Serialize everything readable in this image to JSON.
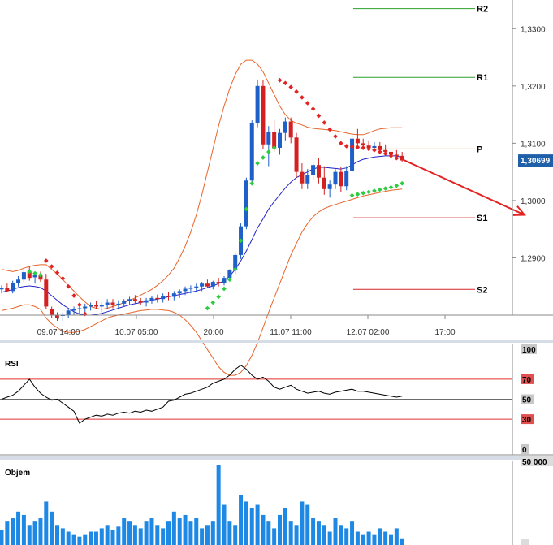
{
  "chart_data": {
    "type": "candlestick",
    "price_panel": {
      "ylim": [
        1.28,
        1.335
      ],
      "y_ticks": [
        "1,3300",
        "1,3200",
        "1,3100",
        "1,3000",
        "1,2900"
      ],
      "current_price_label": "1,30699",
      "x_ticks": [
        "09.07 14:00",
        "10.07 05:00",
        "20:00",
        "11.07 11:00",
        "12.07 02:00",
        "17:00"
      ],
      "pivot_levels": [
        {
          "name": "R2",
          "value": 1.3335,
          "color": "#2ca02c"
        },
        {
          "name": "R1",
          "value": 1.3215,
          "color": "#2ca02c"
        },
        {
          "name": "P",
          "value": 1.309,
          "color": "#f0a030"
        },
        {
          "name": "S1",
          "value": 1.297,
          "color": "#d62728"
        },
        {
          "name": "S2",
          "value": 1.2845,
          "color": "#d62728"
        }
      ],
      "candles": [
        [
          1.2845,
          1.2852,
          1.2838,
          1.2848
        ],
        [
          1.2848,
          1.2855,
          1.284,
          1.2842
        ],
        [
          1.2842,
          1.286,
          1.2838,
          1.2856
        ],
        [
          1.2856,
          1.2868,
          1.285,
          1.2862
        ],
        [
          1.2862,
          1.288,
          1.2855,
          1.2875
        ],
        [
          1.2875,
          1.2885,
          1.286,
          1.2865
        ],
        [
          1.2866,
          1.2875,
          1.2855,
          1.287
        ],
        [
          1.287,
          1.2876,
          1.2858,
          1.2862
        ],
        [
          1.2862,
          1.2872,
          1.281,
          1.2815
        ],
        [
          1.281,
          1.2815,
          1.2795,
          1.28
        ],
        [
          1.28,
          1.2805,
          1.279,
          1.2795
        ],
        [
          1.28,
          1.2805,
          1.279,
          1.28
        ],
        [
          1.28,
          1.2812,
          1.2795,
          1.2808
        ],
        [
          1.2808,
          1.2815,
          1.28,
          1.281
        ],
        [
          1.281,
          1.2818,
          1.28,
          1.2812
        ],
        [
          1.2812,
          1.282,
          1.2805,
          1.2815
        ],
        [
          1.2815,
          1.2822,
          1.2808,
          1.2818
        ],
        [
          1.2818,
          1.2825,
          1.281,
          1.2815
        ],
        [
          1.2815,
          1.2822,
          1.2805,
          1.2818
        ],
        [
          1.2818,
          1.2828,
          1.281,
          1.2822
        ],
        [
          1.2822,
          1.2828,
          1.2812,
          1.2818
        ],
        [
          1.2818,
          1.2826,
          1.2812,
          1.282
        ],
        [
          1.282,
          1.2828,
          1.2815,
          1.2825
        ],
        [
          1.2825,
          1.2832,
          1.2818,
          1.2828
        ],
        [
          1.2828,
          1.2835,
          1.282,
          1.2825
        ],
        [
          1.2825,
          1.283,
          1.2818,
          1.2822
        ],
        [
          1.2822,
          1.283,
          1.2815,
          1.2826
        ],
        [
          1.2826,
          1.2834,
          1.282,
          1.283
        ],
        [
          1.283,
          1.2836,
          1.2822,
          1.2828
        ],
        [
          1.2828,
          1.2838,
          1.2822,
          1.2834
        ],
        [
          1.2834,
          1.284,
          1.2826,
          1.2832
        ],
        [
          1.2832,
          1.2842,
          1.2826,
          1.2838
        ],
        [
          1.2838,
          1.2845,
          1.283,
          1.2842
        ],
        [
          1.2842,
          1.285,
          1.2835,
          1.2846
        ],
        [
          1.2846,
          1.2852,
          1.2838,
          1.2848
        ],
        [
          1.2848,
          1.2855,
          1.284,
          1.285
        ],
        [
          1.285,
          1.2858,
          1.2842,
          1.2855
        ],
        [
          1.2855,
          1.2862,
          1.2848,
          1.285
        ],
        [
          1.285,
          1.286,
          1.2845,
          1.2858
        ],
        [
          1.2858,
          1.2865,
          1.285,
          1.2856
        ],
        [
          1.2856,
          1.2868,
          1.2852,
          1.2865
        ],
        [
          1.2865,
          1.288,
          1.286,
          1.2878
        ],
        [
          1.2878,
          1.291,
          1.2872,
          1.2905
        ],
        [
          1.2905,
          1.296,
          1.2898,
          1.2955
        ],
        [
          1.2955,
          1.304,
          1.295,
          1.3035
        ],
        [
          1.3035,
          1.314,
          1.303,
          1.3135
        ],
        [
          1.3135,
          1.321,
          1.3128,
          1.32
        ],
        [
          1.32,
          1.321,
          1.309,
          1.3098
        ],
        [
          1.3098,
          1.313,
          1.306,
          1.312
        ],
        [
          1.312,
          1.314,
          1.3085,
          1.3092
        ],
        [
          1.3092,
          1.3125,
          1.308,
          1.3118
        ],
        [
          1.3118,
          1.3145,
          1.3105,
          1.3138
        ],
        [
          1.3138,
          1.3145,
          1.31,
          1.311
        ],
        [
          1.311,
          1.3118,
          1.304,
          1.305
        ],
        [
          1.305,
          1.3065,
          1.302,
          1.303
        ],
        [
          1.303,
          1.3055,
          1.302,
          1.3045
        ],
        [
          1.3045,
          1.307,
          1.3035,
          1.3062
        ],
        [
          1.3062,
          1.3075,
          1.303,
          1.304
        ],
        [
          1.304,
          1.306,
          1.301,
          1.302
        ],
        [
          1.302,
          1.3035,
          1.3005,
          1.3028
        ],
        [
          1.3028,
          1.3055,
          1.302,
          1.305
        ],
        [
          1.305,
          1.3058,
          1.3015,
          1.3025
        ],
        [
          1.3025,
          1.306,
          1.3018,
          1.3052
        ],
        [
          1.3052,
          1.3112,
          1.3048,
          1.3108
        ],
        [
          1.3108,
          1.3125,
          1.3095,
          1.31
        ],
        [
          1.31,
          1.3108,
          1.3092,
          1.3096
        ],
        [
          1.3096,
          1.3105,
          1.3088,
          1.3092
        ],
        [
          1.3092,
          1.3102,
          1.3085,
          1.3095
        ],
        [
          1.3095,
          1.3102,
          1.3086,
          1.3088
        ],
        [
          1.3088,
          1.3098,
          1.308,
          1.3085
        ],
        [
          1.3085,
          1.3092,
          1.3075,
          1.308
        ],
        [
          1.308,
          1.3088,
          1.3072,
          1.3078
        ],
        [
          1.3078,
          1.3085,
          1.3068,
          1.307
        ]
      ],
      "sma": [
        1.284,
        1.2842,
        1.2845,
        1.2848,
        1.285,
        1.2851,
        1.285,
        1.2848,
        1.2842,
        1.2834,
        1.2826,
        1.2818,
        1.2812,
        1.2806,
        1.2802,
        1.28,
        1.28,
        1.2801,
        1.2803,
        1.2806,
        1.2809,
        1.2812,
        1.2815,
        1.2818,
        1.282,
        1.2822,
        1.2824,
        1.2826,
        1.2828,
        1.283,
        1.2832,
        1.2834,
        1.2836,
        1.2838,
        1.284,
        1.2842,
        1.2845,
        1.2848,
        1.2851,
        1.2855,
        1.286,
        1.2868,
        1.288,
        1.2895,
        1.2912,
        1.2932,
        1.2952,
        1.2968,
        1.2985,
        1.2998,
        1.301,
        1.3022,
        1.3032,
        1.304,
        1.3045,
        1.305,
        1.3055,
        1.3058,
        1.3058,
        1.3057,
        1.3056,
        1.3055,
        1.3057,
        1.3062,
        1.3068,
        1.3072,
        1.3074,
        1.3076,
        1.3077,
        1.3078,
        1.3078,
        1.3078,
        1.3075
      ],
      "bollinger_upper": [
        1.288,
        1.2878,
        1.2876,
        1.2878,
        1.2882,
        1.2885,
        1.2887,
        1.2888,
        1.2888,
        1.288,
        1.2872,
        1.2862,
        1.2852,
        1.2842,
        1.2832,
        1.2823,
        1.2815,
        1.2812,
        1.281,
        1.2812,
        1.2815,
        1.2818,
        1.2822,
        1.2826,
        1.283,
        1.2835,
        1.284,
        1.2845,
        1.2852,
        1.286,
        1.287,
        1.2882,
        1.29,
        1.292,
        1.2945,
        1.2975,
        1.301,
        1.305,
        1.309,
        1.313,
        1.3165,
        1.3195,
        1.322,
        1.3238,
        1.3245,
        1.3245,
        1.3238,
        1.3225,
        1.3205,
        1.3185,
        1.3165,
        1.315,
        1.314,
        1.3135,
        1.3132,
        1.3128,
        1.3126,
        1.3125,
        1.3124,
        1.3123,
        1.3122,
        1.312,
        1.3118,
        1.3116,
        1.3115,
        1.3115,
        1.3118,
        1.3122,
        1.3125,
        1.3126,
        1.3127,
        1.3127,
        1.3127
      ],
      "bollinger_lower": [
        1.2808,
        1.281,
        1.2812,
        1.2815,
        1.2818,
        1.2818,
        1.2815,
        1.281,
        1.2795,
        1.2785,
        1.2778,
        1.2772,
        1.277,
        1.277,
        1.2772,
        1.2775,
        1.278,
        1.2785,
        1.279,
        1.2795,
        1.2798,
        1.28,
        1.2802,
        1.2804,
        1.2806,
        1.2808,
        1.2809,
        1.281,
        1.281,
        1.2809,
        1.2808,
        1.2805,
        1.28,
        1.2792,
        1.2782,
        1.277,
        1.2755,
        1.274,
        1.2725,
        1.271,
        1.27,
        1.2695,
        1.2695,
        1.27,
        1.2712,
        1.273,
        1.2752,
        1.2778,
        1.2805,
        1.283,
        1.2855,
        1.288,
        1.2905,
        1.2925,
        1.2945,
        1.296,
        1.2972,
        1.298,
        1.2986,
        1.299,
        1.2993,
        1.2996,
        1.2999,
        1.3002,
        1.3005,
        1.3008,
        1.301,
        1.3012,
        1.3014,
        1.3016,
        1.3018,
        1.3019,
        1.302
      ],
      "parabolic_sar": [
        {
          "x": 5,
          "y": 1.2876,
          "color": "#2ecc40"
        },
        {
          "x": 6,
          "y": 1.2873,
          "color": "#2ecc40"
        },
        {
          "x": 7,
          "y": 1.287,
          "color": "#2ecc40"
        },
        {
          "x": 8,
          "y": 1.2895,
          "color": "#e32222"
        },
        {
          "x": 9,
          "y": 1.2885,
          "color": "#e32222"
        },
        {
          "x": 10,
          "y": 1.2874,
          "color": "#e32222"
        },
        {
          "x": 11,
          "y": 1.2864,
          "color": "#e32222"
        },
        {
          "x": 12,
          "y": 1.285,
          "color": "#e32222"
        },
        {
          "x": 13,
          "y": 1.2834,
          "color": "#e32222"
        },
        {
          "x": 14,
          "y": 1.2818,
          "color": "#e32222"
        },
        {
          "x": 15,
          "y": 1.2802,
          "color": "#e32222"
        },
        {
          "x": 37,
          "y": 1.2812,
          "color": "#2ecc40"
        },
        {
          "x": 38,
          "y": 1.2822,
          "color": "#2ecc40"
        },
        {
          "x": 39,
          "y": 1.2832,
          "color": "#2ecc40"
        },
        {
          "x": 40,
          "y": 1.2846,
          "color": "#2ecc40"
        },
        {
          "x": 41,
          "y": 1.2862,
          "color": "#2ecc40"
        },
        {
          "x": 42,
          "y": 1.288,
          "color": "#2ecc40"
        },
        {
          "x": 43,
          "y": 1.293,
          "color": "#2ecc40"
        },
        {
          "x": 44,
          "y": 1.2985,
          "color": "#2ecc40"
        },
        {
          "x": 45,
          "y": 1.303,
          "color": "#2ecc40"
        },
        {
          "x": 46,
          "y": 1.3065,
          "color": "#2ecc40"
        },
        {
          "x": 47,
          "y": 1.3075,
          "color": "#2ecc40"
        },
        {
          "x": 48,
          "y": 1.3085,
          "color": "#2ecc40"
        },
        {
          "x": 49,
          "y": 1.3092,
          "color": "#2ecc40"
        },
        {
          "x": 50,
          "y": 1.321,
          "color": "#e32222"
        },
        {
          "x": 51,
          "y": 1.3205,
          "color": "#e32222"
        },
        {
          "x": 52,
          "y": 1.3198,
          "color": "#e32222"
        },
        {
          "x": 53,
          "y": 1.319,
          "color": "#e32222"
        },
        {
          "x": 54,
          "y": 1.318,
          "color": "#e32222"
        },
        {
          "x": 55,
          "y": 1.317,
          "color": "#e32222"
        },
        {
          "x": 56,
          "y": 1.316,
          "color": "#e32222"
        },
        {
          "x": 57,
          "y": 1.3148,
          "color": "#e32222"
        },
        {
          "x": 58,
          "y": 1.3136,
          "color": "#e32222"
        },
        {
          "x": 59,
          "y": 1.3124,
          "color": "#e32222"
        },
        {
          "x": 60,
          "y": 1.3112,
          "color": "#e32222"
        },
        {
          "x": 61,
          "y": 1.31,
          "color": "#e32222"
        },
        {
          "x": 62,
          "y": 1.3095,
          "color": "#e32222"
        },
        {
          "x": 63,
          "y": 1.3094,
          "color": "#e32222"
        },
        {
          "x": 64,
          "y": 1.3093,
          "color": "#e32222"
        },
        {
          "x": 65,
          "y": 1.3092,
          "color": "#e32222"
        },
        {
          "x": 66,
          "y": 1.309,
          "color": "#e32222"
        },
        {
          "x": 67,
          "y": 1.3088,
          "color": "#e32222"
        },
        {
          "x": 68,
          "y": 1.3085,
          "color": "#e32222"
        },
        {
          "x": 69,
          "y": 1.3082,
          "color": "#e32222"
        },
        {
          "x": 70,
          "y": 1.3078,
          "color": "#e32222"
        },
        {
          "x": 71,
          "y": 1.3074,
          "color": "#e32222"
        },
        {
          "x": 63,
          "y": 1.3009,
          "color": "#2ecc40"
        },
        {
          "x": 64,
          "y": 1.3011,
          "color": "#2ecc40"
        },
        {
          "x": 65,
          "y": 1.3013,
          "color": "#2ecc40"
        },
        {
          "x": 66,
          "y": 1.3015,
          "color": "#2ecc40"
        },
        {
          "x": 67,
          "y": 1.3017,
          "color": "#2ecc40"
        },
        {
          "x": 68,
          "y": 1.3019,
          "color": "#2ecc40"
        },
        {
          "x": 69,
          "y": 1.3021,
          "color": "#2ecc40"
        },
        {
          "x": 70,
          "y": 1.3023,
          "color": "#2ecc40"
        },
        {
          "x": 71,
          "y": 1.3026,
          "color": "#2ecc40"
        },
        {
          "x": 72,
          "y": 1.303,
          "color": "#2ecc40"
        }
      ],
      "forecast_arrow": {
        "from": [
          72,
          1.3072
        ],
        "to": [
          94,
          1.2975
        ],
        "color": "#e32222"
      }
    },
    "rsi_panel": {
      "title": "RSI",
      "ylim": [
        0,
        100
      ],
      "levels": [
        {
          "value": 70,
          "label": "70"
        },
        {
          "value": 50,
          "label": "50"
        },
        {
          "value": 30,
          "label": "30"
        }
      ],
      "scale_labels": [
        "100",
        "0"
      ],
      "values": [
        50,
        52,
        54,
        58,
        64,
        70,
        62,
        56,
        52,
        49,
        50,
        46,
        42,
        38,
        26,
        30,
        32,
        34,
        33,
        35,
        34,
        36,
        37,
        36,
        38,
        37,
        39,
        38,
        40,
        42,
        48,
        49,
        52,
        55,
        56,
        58,
        60,
        62,
        66,
        68,
        70,
        74,
        80,
        84,
        80,
        74,
        70,
        72,
        68,
        62,
        60,
        62,
        64,
        60,
        58,
        56,
        57,
        58,
        56,
        55,
        57,
        58,
        59,
        60,
        58,
        58,
        57,
        56,
        55,
        54,
        53,
        52,
        53
      ],
      "value_y_positions_note": "values on 0-100 RSI scale"
    },
    "volume_panel": {
      "title": "Objem",
      "scale_label": "50 000",
      "ylim": [
        0,
        50000
      ],
      "values": [
        9000,
        14000,
        16000,
        20000,
        18000,
        12000,
        14000,
        16000,
        26000,
        20000,
        12000,
        10000,
        8000,
        6000,
        5000,
        6000,
        8000,
        8000,
        10000,
        12000,
        9000,
        11000,
        16000,
        14000,
        12000,
        10000,
        14000,
        16000,
        12000,
        10000,
        14000,
        20000,
        16000,
        18000,
        14000,
        16000,
        10000,
        12000,
        14000,
        48000,
        24000,
        14000,
        12000,
        30000,
        26000,
        22000,
        24000,
        18000,
        14000,
        10000,
        18000,
        22000,
        14000,
        12000,
        26000,
        24000,
        16000,
        14000,
        12000,
        8000,
        16000,
        12000,
        10000,
        14000,
        8000,
        6000,
        8000,
        6000,
        10000,
        8000,
        6000,
        10000,
        4000
      ]
    }
  }
}
